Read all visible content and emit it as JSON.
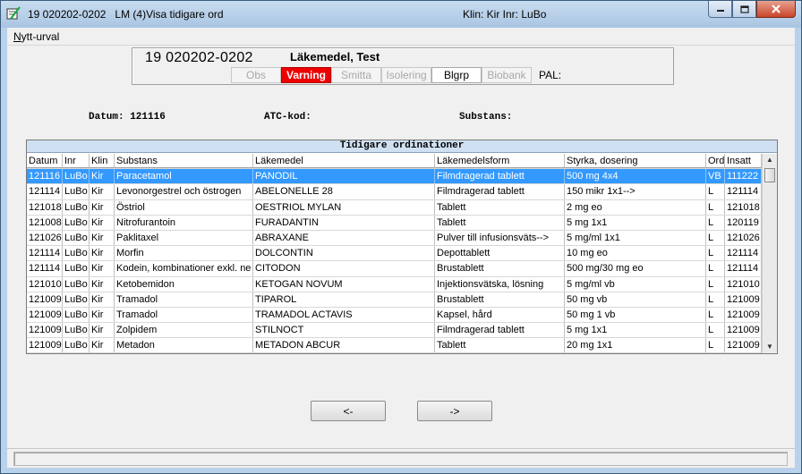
{
  "window": {
    "title": "19 020202-0202   LM (4)Visa tidigare ord",
    "clinic": "Klin: Kir  Inr: LuBo"
  },
  "menu": {
    "item": "Nytt-urval",
    "item_first_letter": "N",
    "item_rest": "ytt-urval"
  },
  "patient": {
    "pnr": "19 020202-0202",
    "name": "Läkemedel, Test",
    "pal_label": "PAL:",
    "flags": [
      {
        "label": "Obs",
        "state": "disabled"
      },
      {
        "label": "Varning",
        "state": "alert"
      },
      {
        "label": "Smitta",
        "state": "disabled"
      },
      {
        "label": "Isolering",
        "state": "disabled"
      },
      {
        "label": "Blgrp",
        "state": "active"
      },
      {
        "label": "Biobank",
        "state": "disabled"
      }
    ]
  },
  "info": {
    "datum": "Datum: 121116",
    "atc": "ATC-kod:",
    "substans": "Substans:"
  },
  "table": {
    "caption": "Tidigare ordinationer",
    "columns": [
      "Datum",
      "Inr",
      "Klin",
      "Substans",
      "Läkemedel",
      "Läkemedelsform",
      "Styrka, dosering",
      "Ord",
      "Insatt"
    ],
    "selected_row": 0,
    "rows": [
      [
        "121116",
        "LuBo",
        "Kir",
        "Paracetamol",
        "PANODIL",
        "Filmdragerad tablett",
        "500 mg 4x4",
        "VB",
        "111222"
      ],
      [
        "121114",
        "LuBo",
        "Kir",
        "Levonorgestrel och östrogen",
        "ABELONELLE 28",
        "Filmdragerad tablett",
        "150 mikr 1x1-->",
        "L",
        "121114"
      ],
      [
        "121018",
        "LuBo",
        "Kir",
        "Östriol",
        "OESTRIOL MYLAN",
        "Tablett",
        "2 mg eo",
        "L",
        "121018"
      ],
      [
        "121008",
        "LuBo",
        "Kir",
        "Nitrofurantoin",
        "FURADANTIN",
        "Tablett",
        "5 mg 1x1",
        "L",
        "120119"
      ],
      [
        "121026",
        "LuBo",
        "Kir",
        "Paklitaxel",
        "ABRAXANE",
        "Pulver till infusionsväts-->",
        "5 mg/ml 1x1",
        "L",
        "121026"
      ],
      [
        "121114",
        "LuBo",
        "Kir",
        "Morfin",
        "DOLCONTIN",
        "Depottablett",
        "10 mg eo",
        "L",
        "121114"
      ],
      [
        "121114",
        "LuBo",
        "Kir",
        "Kodein, kombinationer exkl. ne",
        "CITODON",
        "Brustablett",
        "500 mg/30 mg eo",
        "L",
        "121114"
      ],
      [
        "121010",
        "LuBo",
        "Kir",
        "Ketobemidon",
        "KETOGAN NOVUM",
        "Injektionsvätska, lösning",
        "5 mg/ml vb",
        "L",
        "121010"
      ],
      [
        "121009",
        "LuBo",
        "Kir",
        "Tramadol",
        "TIPAROL",
        "Brustablett",
        "50 mg vb",
        "L",
        "121009"
      ],
      [
        "121009",
        "LuBo",
        "Kir",
        "Tramadol",
        "TRAMADOL ACTAVIS",
        "Kapsel, hård",
        "50 mg 1 vb",
        "L",
        "121009"
      ],
      [
        "121009",
        "LuBo",
        "Kir",
        "Zolpidem",
        "STILNOCT",
        "Filmdragerad tablett",
        "5 mg 1x1",
        "L",
        "121009"
      ],
      [
        "121009",
        "LuBo",
        "Kir",
        "Metadon",
        "METADON ABCUR",
        "Tablett",
        "20 mg 1x1",
        "L",
        "121009"
      ]
    ]
  },
  "nav": {
    "prev": "<-",
    "next": "->"
  },
  "icons": {
    "app": "app-icon",
    "minimize": "minimize-icon",
    "maximize": "maximize-icon",
    "close": "close-icon",
    "scroll_up": "arrow-up-icon",
    "scroll_down": "arrow-down-icon"
  },
  "colors": {
    "warning_flag": "#ee0000",
    "selection": "#3399ff",
    "title_bar": "#b9d1ea"
  }
}
